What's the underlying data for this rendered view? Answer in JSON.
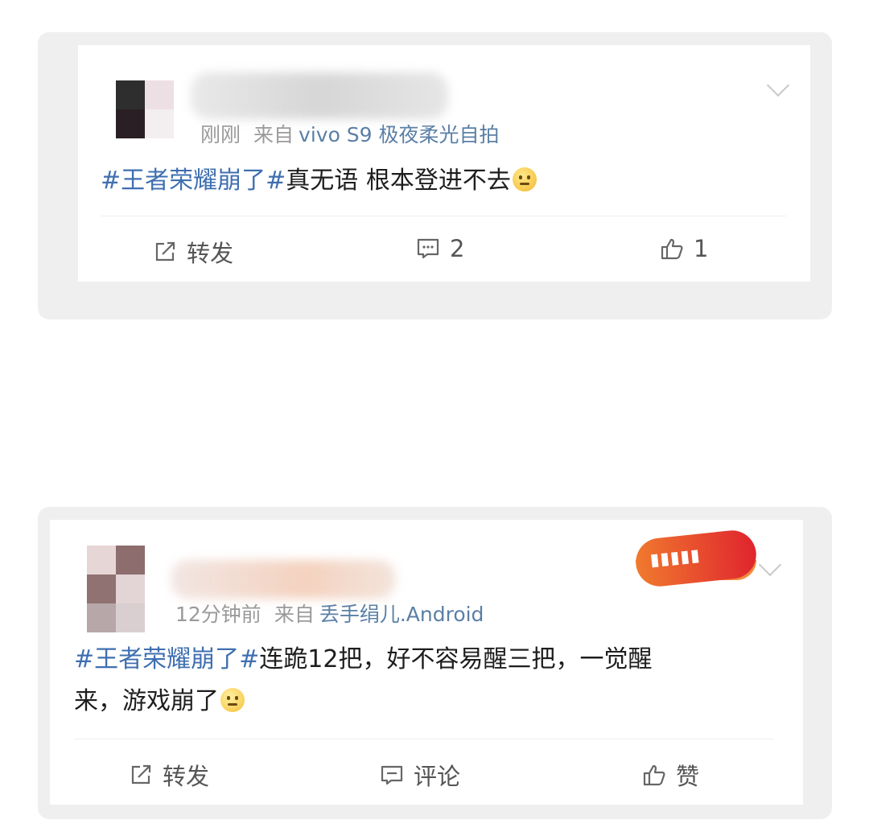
{
  "posts": [
    {
      "time": "刚刚",
      "source_prefix": "来自",
      "device": "vivo S9 极夜柔光自拍",
      "hashtag": "#王者荣耀崩了#",
      "text_line1": "真无语  根本登进不去",
      "text_line2": "",
      "actions": {
        "repost": "转发",
        "comment": "2",
        "like": "1"
      }
    },
    {
      "time": "12分钟前",
      "source_prefix": "来自",
      "device": "丢手绢儿.Android",
      "hashtag": "#王者荣耀崩了#",
      "text_line1": "连跪12把，好不容易醒三把，一觉醒",
      "text_line2": "来，游戏崩了",
      "actions": {
        "repost": "转发",
        "comment": "评论",
        "like": "赞"
      }
    }
  ],
  "icons": {
    "repost": "repost-icon",
    "comment": "comment-icon",
    "like": "thumbs-up-icon",
    "menu": "chevron-down-icon",
    "emoji": "emoji-icon"
  },
  "colors": {
    "hashtag": "#3f6fb0",
    "device": "#5b7fa6",
    "meta": "#9a9a9a",
    "card_frame": "#efefef"
  }
}
